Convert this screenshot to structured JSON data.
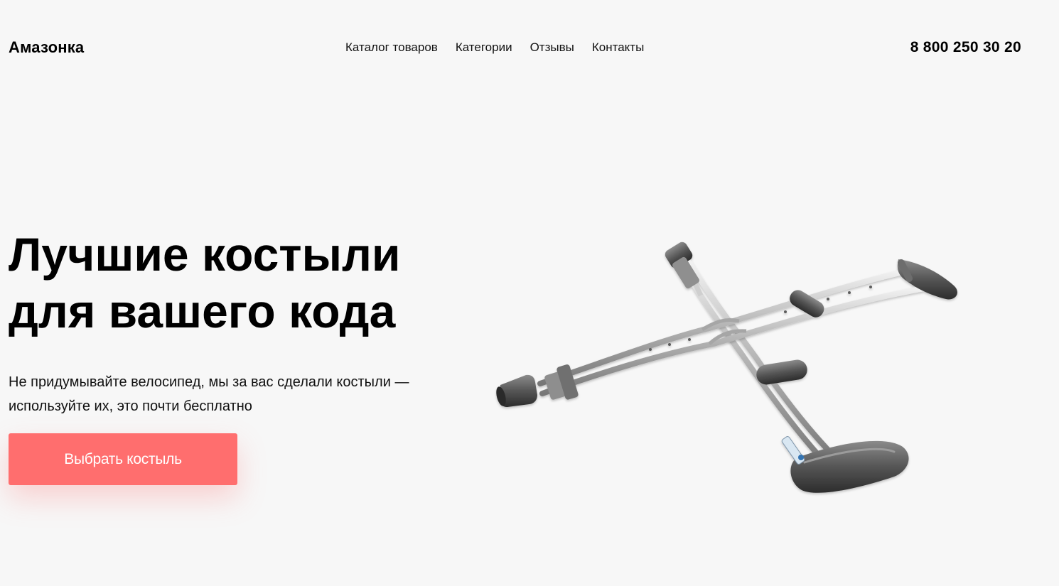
{
  "header": {
    "logo": "Амазонка",
    "nav": [
      {
        "label": "Каталог товаров"
      },
      {
        "label": "Категории"
      },
      {
        "label": "Отзывы"
      },
      {
        "label": "Контакты"
      }
    ],
    "phone": "8 800 250 30 20"
  },
  "hero": {
    "title_line1": "Лучшие костыли",
    "title_line2": "для вашего кода",
    "description_line1": "Не придумывайте велосипед, мы за вас сделали костыли —",
    "description_line2": "используйте их, это почти бесплатно",
    "cta_label": "Выбрать костыль",
    "product_image": "crutches-image"
  },
  "colors": {
    "background": "#f7f7f7",
    "accent": "#ff6e6e",
    "text": "#000000"
  }
}
